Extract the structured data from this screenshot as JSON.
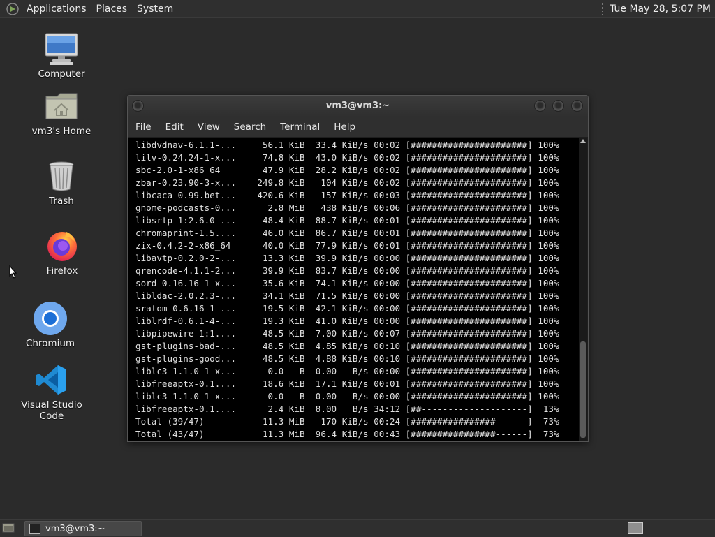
{
  "top_panel": {
    "menu": [
      "Applications",
      "Places",
      "System"
    ],
    "clock": "Tue May 28,  5:07 PM"
  },
  "desktop_icons": [
    {
      "label": "Computer",
      "icon": "computer-icon"
    },
    {
      "label": "vm3's Home",
      "icon": "home-folder-icon"
    },
    {
      "label": "Trash",
      "icon": "trash-icon"
    },
    {
      "label": "Firefox",
      "icon": "firefox-icon"
    },
    {
      "label": "Chromium",
      "icon": "chromium-icon"
    },
    {
      "label": "Visual Studio Code",
      "icon": "vscode-icon"
    }
  ],
  "terminal": {
    "title": "vm3@vm3:~",
    "menu": [
      "File",
      "Edit",
      "View",
      "Search",
      "Terminal",
      "Help"
    ],
    "lines": [
      "libdvdnav-6.1.1-...     56.1 KiB  33.4 KiB/s 00:02 [######################] 100%",
      "lilv-0.24.24-1-x...     74.8 KiB  43.0 KiB/s 00:02 [######################] 100%",
      "sbc-2.0-1-x86_64        47.9 KiB  28.2 KiB/s 00:02 [######################] 100%",
      "zbar-0.23.90-3-x...    249.8 KiB   104 KiB/s 00:02 [######################] 100%",
      "libcaca-0.99.bet...    420.6 KiB   157 KiB/s 00:03 [######################] 100%",
      "gnome-podcasts-0...      2.8 MiB   438 KiB/s 00:06 [######################] 100%",
      "libsrtp-1:2.6.0-...     48.4 KiB  88.7 KiB/s 00:01 [######################] 100%",
      "chromaprint-1.5....     46.0 KiB  86.7 KiB/s 00:01 [######################] 100%",
      "zix-0.4.2-2-x86_64      40.0 KiB  77.9 KiB/s 00:01 [######################] 100%",
      "libavtp-0.2.0-2-...     13.3 KiB  39.9 KiB/s 00:00 [######################] 100%",
      "qrencode-4.1.1-2...     39.9 KiB  83.7 KiB/s 00:00 [######################] 100%",
      "sord-0.16.16-1-x...     35.6 KiB  74.1 KiB/s 00:00 [######################] 100%",
      "libldac-2.0.2.3-...     34.1 KiB  71.5 KiB/s 00:00 [######################] 100%",
      "sratom-0.6.16-1-...     19.5 KiB  42.1 KiB/s 00:00 [######################] 100%",
      "liblrdf-0.6.1-4-...     19.3 KiB  41.0 KiB/s 00:00 [######################] 100%",
      "libpipewire-1:1....     48.5 KiB  7.00 KiB/s 00:07 [######################] 100%",
      "gst-plugins-bad-...     48.5 KiB  4.85 KiB/s 00:10 [######################] 100%",
      "gst-plugins-good...     48.5 KiB  4.88 KiB/s 00:10 [######################] 100%",
      "liblc3-1.1.0-1-x...      0.0   B  0.00   B/s 00:00 [######################] 100%",
      "libfreeaptx-0.1....     18.6 KiB  17.1 KiB/s 00:01 [######################] 100%",
      "liblc3-1.1.0-1-x...      0.0   B  0.00   B/s 00:00 [######################] 100%",
      "libfreeaptx-0.1....      2.4 KiB  8.00   B/s 34:12 [##--------------------]  13%",
      "Total (39/47)           11.3 MiB   170 KiB/s 00:24 [################------]  73%",
      "Total (43/47)           11.3 MiB  96.4 KiB/s 00:43 [################------]  73%"
    ]
  },
  "taskbar": {
    "window_button": "vm3@vm3:~"
  },
  "colors": {
    "desktop_bg": "#2b2b2b",
    "panel_bg": "#2f2f2f",
    "terminal_bg": "#000000"
  }
}
